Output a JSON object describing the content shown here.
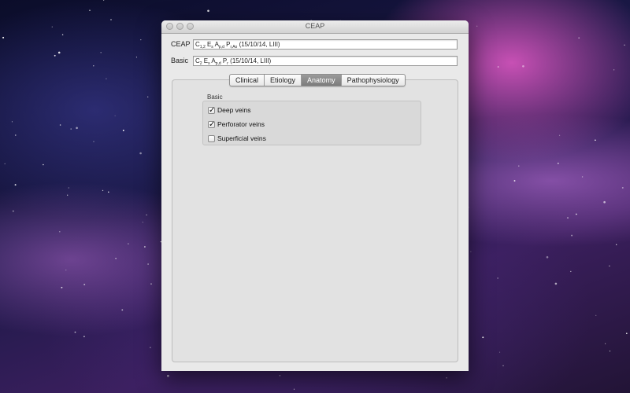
{
  "window": {
    "title": "CEAP"
  },
  "fields": {
    "ceap": {
      "label": "CEAP",
      "parts": [
        {
          "t": "C"
        },
        {
          "s": "1,2"
        },
        {
          "t": " E"
        },
        {
          "s": "s"
        },
        {
          "t": " A"
        },
        {
          "s": "p,d"
        },
        {
          "t": " P"
        },
        {
          "s": "r,Ao"
        },
        {
          "t": " (15/10/14, LIII)"
        }
      ]
    },
    "basic": {
      "label": "Basic",
      "parts": [
        {
          "t": "C"
        },
        {
          "s": "2"
        },
        {
          "t": " E"
        },
        {
          "s": "s"
        },
        {
          "t": " A"
        },
        {
          "s": "p,d"
        },
        {
          "t": " P"
        },
        {
          "s": "r"
        },
        {
          "t": " (15/10/14, LIII)"
        }
      ]
    }
  },
  "tabs": [
    {
      "label": "Clinical",
      "active": false
    },
    {
      "label": "Etiology",
      "active": false
    },
    {
      "label": "Anatomy",
      "active": true
    },
    {
      "label": "Pathophysiology",
      "active": false
    }
  ],
  "anatomy": {
    "group_label": "Basic",
    "options": [
      {
        "label": "Deep veins",
        "checked": true
      },
      {
        "label": "Perforator veins",
        "checked": true
      },
      {
        "label": "Superficial veins",
        "checked": false
      }
    ]
  }
}
